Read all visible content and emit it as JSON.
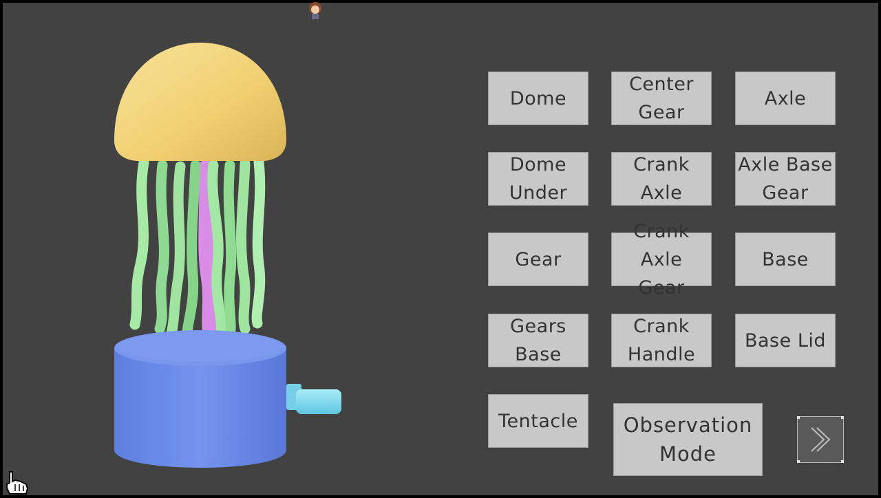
{
  "parts": {
    "items": [
      {
        "label": "Dome"
      },
      {
        "label": "Center\nGear"
      },
      {
        "label": "Axle"
      },
      {
        "label": "Dome\nUnder"
      },
      {
        "label": "Crank Axle"
      },
      {
        "label": "Axle Base\nGear"
      },
      {
        "label": "Gear"
      },
      {
        "label": "Crank Axle\nGear"
      },
      {
        "label": "Base"
      },
      {
        "label": "Gears Base"
      },
      {
        "label": "Crank\nHandle"
      },
      {
        "label": "Base Lid"
      },
      {
        "label": "Tentacle"
      }
    ]
  },
  "observation": {
    "label": "Observation\nMode"
  },
  "next": {
    "icon": "chevron-right-double-icon"
  },
  "colors": {
    "background": "#424242",
    "button": "#c8c8c8",
    "dome": "#f1d278",
    "tentacle": "#9fe59f",
    "center_tentacle": "#d98de6",
    "base": "#6b8bea",
    "crank": "#7fd8ea"
  }
}
